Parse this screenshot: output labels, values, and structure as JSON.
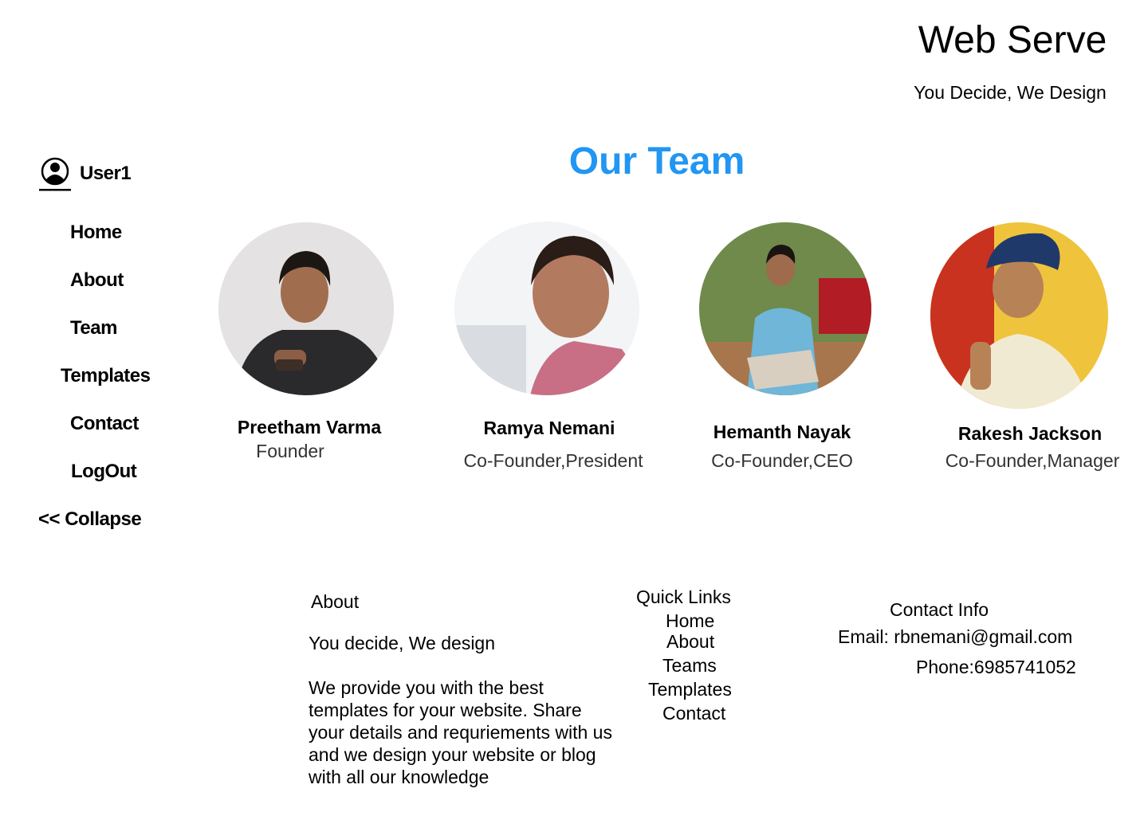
{
  "header": {
    "title": "Web Serve",
    "tagline": "You Decide, We Design"
  },
  "sidebar": {
    "user": "User1",
    "items": [
      {
        "label": "Home"
      },
      {
        "label": "About"
      },
      {
        "label": "Team"
      },
      {
        "label": "Templates"
      },
      {
        "label": "Contact"
      },
      {
        "label": "LogOut"
      },
      {
        "label": "<< Collapse"
      }
    ]
  },
  "main": {
    "title": "Our Team",
    "members": [
      {
        "name": "Preetham Varma",
        "role": "Founder"
      },
      {
        "name": "Ramya Nemani",
        "role": "Co-Founder,President"
      },
      {
        "name": "Hemanth Nayak",
        "role": "Co-Founder,CEO"
      },
      {
        "name": "Rakesh Jackson",
        "role": "Co-Founder,Manager"
      }
    ]
  },
  "footer": {
    "about": {
      "heading": "About",
      "tagline": "You decide, We design",
      "lines": [
        "We provide you with the best",
        "templates for your website. Share",
        "your details and requriements with us",
        "and we design your website or blog",
        "with all our knowledge"
      ]
    },
    "quick_links": {
      "heading": "Quick Links",
      "links": [
        "Home",
        "About",
        "Teams",
        "Templates",
        "Contact"
      ]
    },
    "contact": {
      "heading": "Contact Info",
      "email": "Email: rbnemani@gmail.com",
      "phone": "Phone:6985741052"
    }
  },
  "colors": {
    "accent": "#2196f3"
  }
}
